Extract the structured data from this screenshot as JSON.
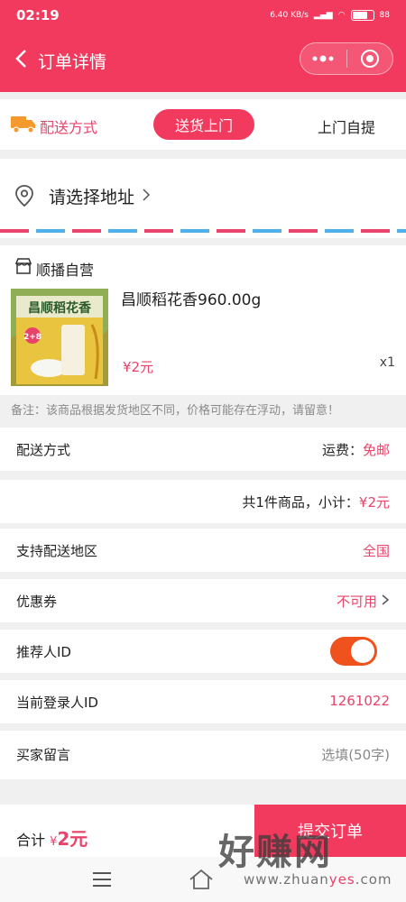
{
  "status_bar": {
    "time": "02:19",
    "speed": "6.40",
    "speed_unit": "KB/s",
    "battery": "88"
  },
  "navbar": {
    "title": "订单详情"
  },
  "delivery": {
    "label": "配送方式",
    "options": [
      "送货上门",
      "上门自提"
    ],
    "selected": "送货上门"
  },
  "address": {
    "prompt": "请选择地址"
  },
  "store": {
    "name": "顺播自营"
  },
  "product": {
    "name": "昌顺稻花香960.00g",
    "price": "¥2元",
    "quantity": "x1",
    "package_text": "昌顺稻花香",
    "package_badge": "2+8"
  },
  "note": "备注：该商品根据发货地区不同，价格可能存在浮动，请留意！",
  "shipping": {
    "label": "配送方式",
    "fee_label": "运费：",
    "fee_value": "免邮"
  },
  "subtotal": {
    "text": "共1件商品，小计：",
    "value": "¥2元"
  },
  "region": {
    "label": "支持配送地区",
    "value": "全国"
  },
  "coupon": {
    "label": "优惠券",
    "value": "不可用"
  },
  "referrer": {
    "label": "推荐人ID",
    "enabled": true
  },
  "login": {
    "label": "当前登录人ID",
    "value": "1261022"
  },
  "message": {
    "label": "买家留言",
    "placeholder": "选填(50字)"
  },
  "footer": {
    "total_label": "合计",
    "currency": "¥",
    "total_value": "2元",
    "submit": "提交订单"
  },
  "watermark": {
    "text": "好赚网",
    "url_a": "www.zhuan",
    "url_b": "yes",
    "url_c": ".com"
  },
  "colors": {
    "brand": "#f23a5e",
    "price": "#e8436b",
    "toggle": "#f0521e"
  }
}
